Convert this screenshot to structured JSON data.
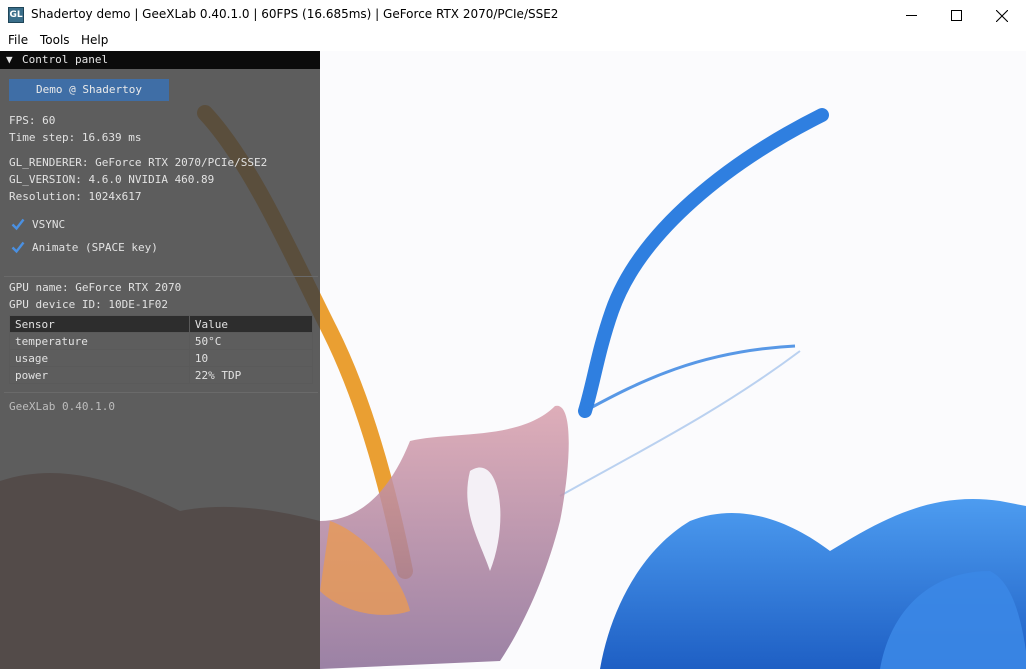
{
  "window": {
    "icon_text": "GL",
    "title": "Shadertoy demo | GeeXLab 0.40.1.0 | 60FPS (16.685ms) | GeForce RTX 2070/PCIe/SSE2"
  },
  "menu": [
    "File",
    "Tools",
    "Help"
  ],
  "panel": {
    "header_label": "Control panel",
    "demo_button": "Demo @ Shadertoy",
    "fps": "FPS: 60",
    "time_step": "Time step: 16.639 ms",
    "gl_renderer": "GL_RENDERER: GeForce RTX 2070/PCIe/SSE2",
    "gl_version": "GL_VERSION: 4.6.0 NVIDIA 460.89",
    "resolution": "Resolution: 1024x617",
    "vsync_label": "VSYNC",
    "vsync_checked": true,
    "animate_label": "Animate (SPACE key)",
    "animate_checked": true,
    "gpu_name": "GPU name: GeForce RTX 2070",
    "gpu_device_id": "GPU device ID: 10DE-1F02",
    "sensor_table": {
      "headers": [
        "Sensor",
        "Value"
      ],
      "rows": [
        [
          "temperature",
          "50°C"
        ],
        [
          "usage",
          "10"
        ],
        [
          "power",
          "22% TDP"
        ]
      ]
    },
    "version": "GeeXLab 0.40.1.0"
  },
  "colors": {
    "panel_bg": "#3e3e3e",
    "button_bg": "#3f6ea6",
    "checkmark": "#4a90e2",
    "paint_blue": "#2f7fe0",
    "paint_orange": "#e8951c",
    "paint_pink": "#c98fa0"
  }
}
